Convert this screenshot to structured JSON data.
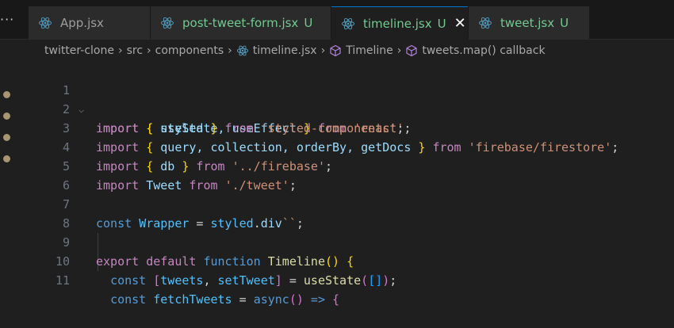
{
  "tabs": [
    {
      "name": "App.jsx",
      "badge": ""
    },
    {
      "name": "post-tweet-form.jsx",
      "badge": "U"
    },
    {
      "name": "timeline.jsx",
      "badge": "U",
      "close": "✕"
    },
    {
      "name": "tweet.jsx",
      "badge": "U"
    }
  ],
  "breadcrumb": {
    "items": [
      "twitter-clone",
      "src",
      "components",
      "timeline.jsx",
      "Timeline",
      "tweets.map() callback"
    ],
    "separator": "›"
  },
  "editor": {
    "line_numbers": [
      "1",
      "2",
      "3",
      "4",
      "5",
      "6",
      "7",
      "8",
      "9",
      "10",
      "11"
    ],
    "lines": [
      [
        "import",
        " ",
        "{",
        " useState, useEffect ",
        "}",
        " from ",
        "'react'",
        ";"
      ],
      [
        "import",
        " ",
        "{",
        " styled ",
        "}",
        " from ",
        "'styled-components'",
        ";"
      ],
      [
        "import",
        " ",
        "{",
        " query, collection, orderBy, getDocs ",
        "}",
        " from ",
        "'firebase/firestore'",
        ";"
      ],
      [
        "import",
        " ",
        "{",
        " db ",
        "}",
        " from ",
        "'../firebase'",
        ";"
      ],
      [
        "import",
        " Tweet ",
        "from",
        " ",
        "'./tweet'",
        ";"
      ],
      [],
      [
        "const",
        " ",
        "Wrapper",
        " = ",
        "styled",
        ".",
        "div",
        "``",
        ";"
      ],
      [],
      [
        "export",
        " ",
        "default",
        " ",
        "function",
        " ",
        "Timeline",
        "(",
        ")",
        " ",
        "{"
      ],
      [
        "  ",
        "const",
        " ",
        "[",
        "tweets",
        ", ",
        "setTweet",
        "]",
        " = ",
        "useState",
        "(",
        "[",
        "]",
        ")",
        ";"
      ],
      [
        "  ",
        "const",
        " ",
        "fetchTweets",
        " = ",
        "async",
        "(",
        ")",
        " => ",
        "{"
      ]
    ]
  },
  "colors": {
    "background": "#1f1f1f",
    "tabbar": "#181818",
    "untracked": "#73c991",
    "accent": "#0078d4"
  },
  "icons": [
    "react-icon",
    "symbol-class-icon",
    "symbol-method-icon",
    "more-icon",
    "close-icon",
    "chevron-down-icon"
  ]
}
